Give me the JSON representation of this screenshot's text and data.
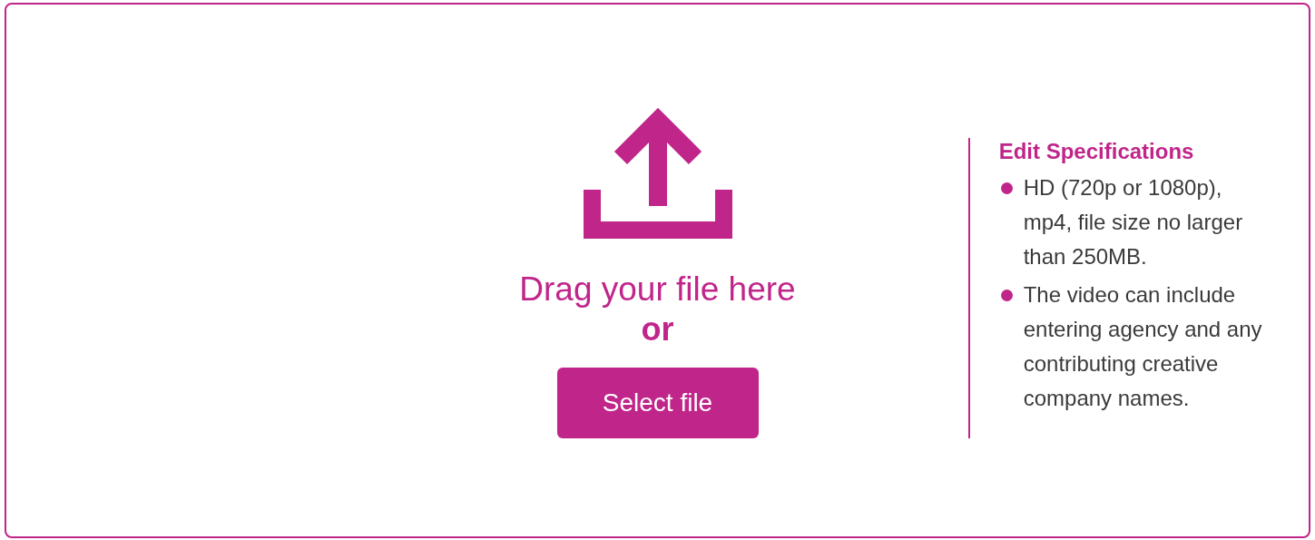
{
  "upload": {
    "prompt": "Drag your file here",
    "separator": "or",
    "button": "Select file"
  },
  "specifications": {
    "title": "Edit Specifications",
    "items": [
      "HD (720p or 1080p), mp4, file size no larger than 250MB.",
      "The video can include entering agency and any contributing creative company names."
    ]
  }
}
